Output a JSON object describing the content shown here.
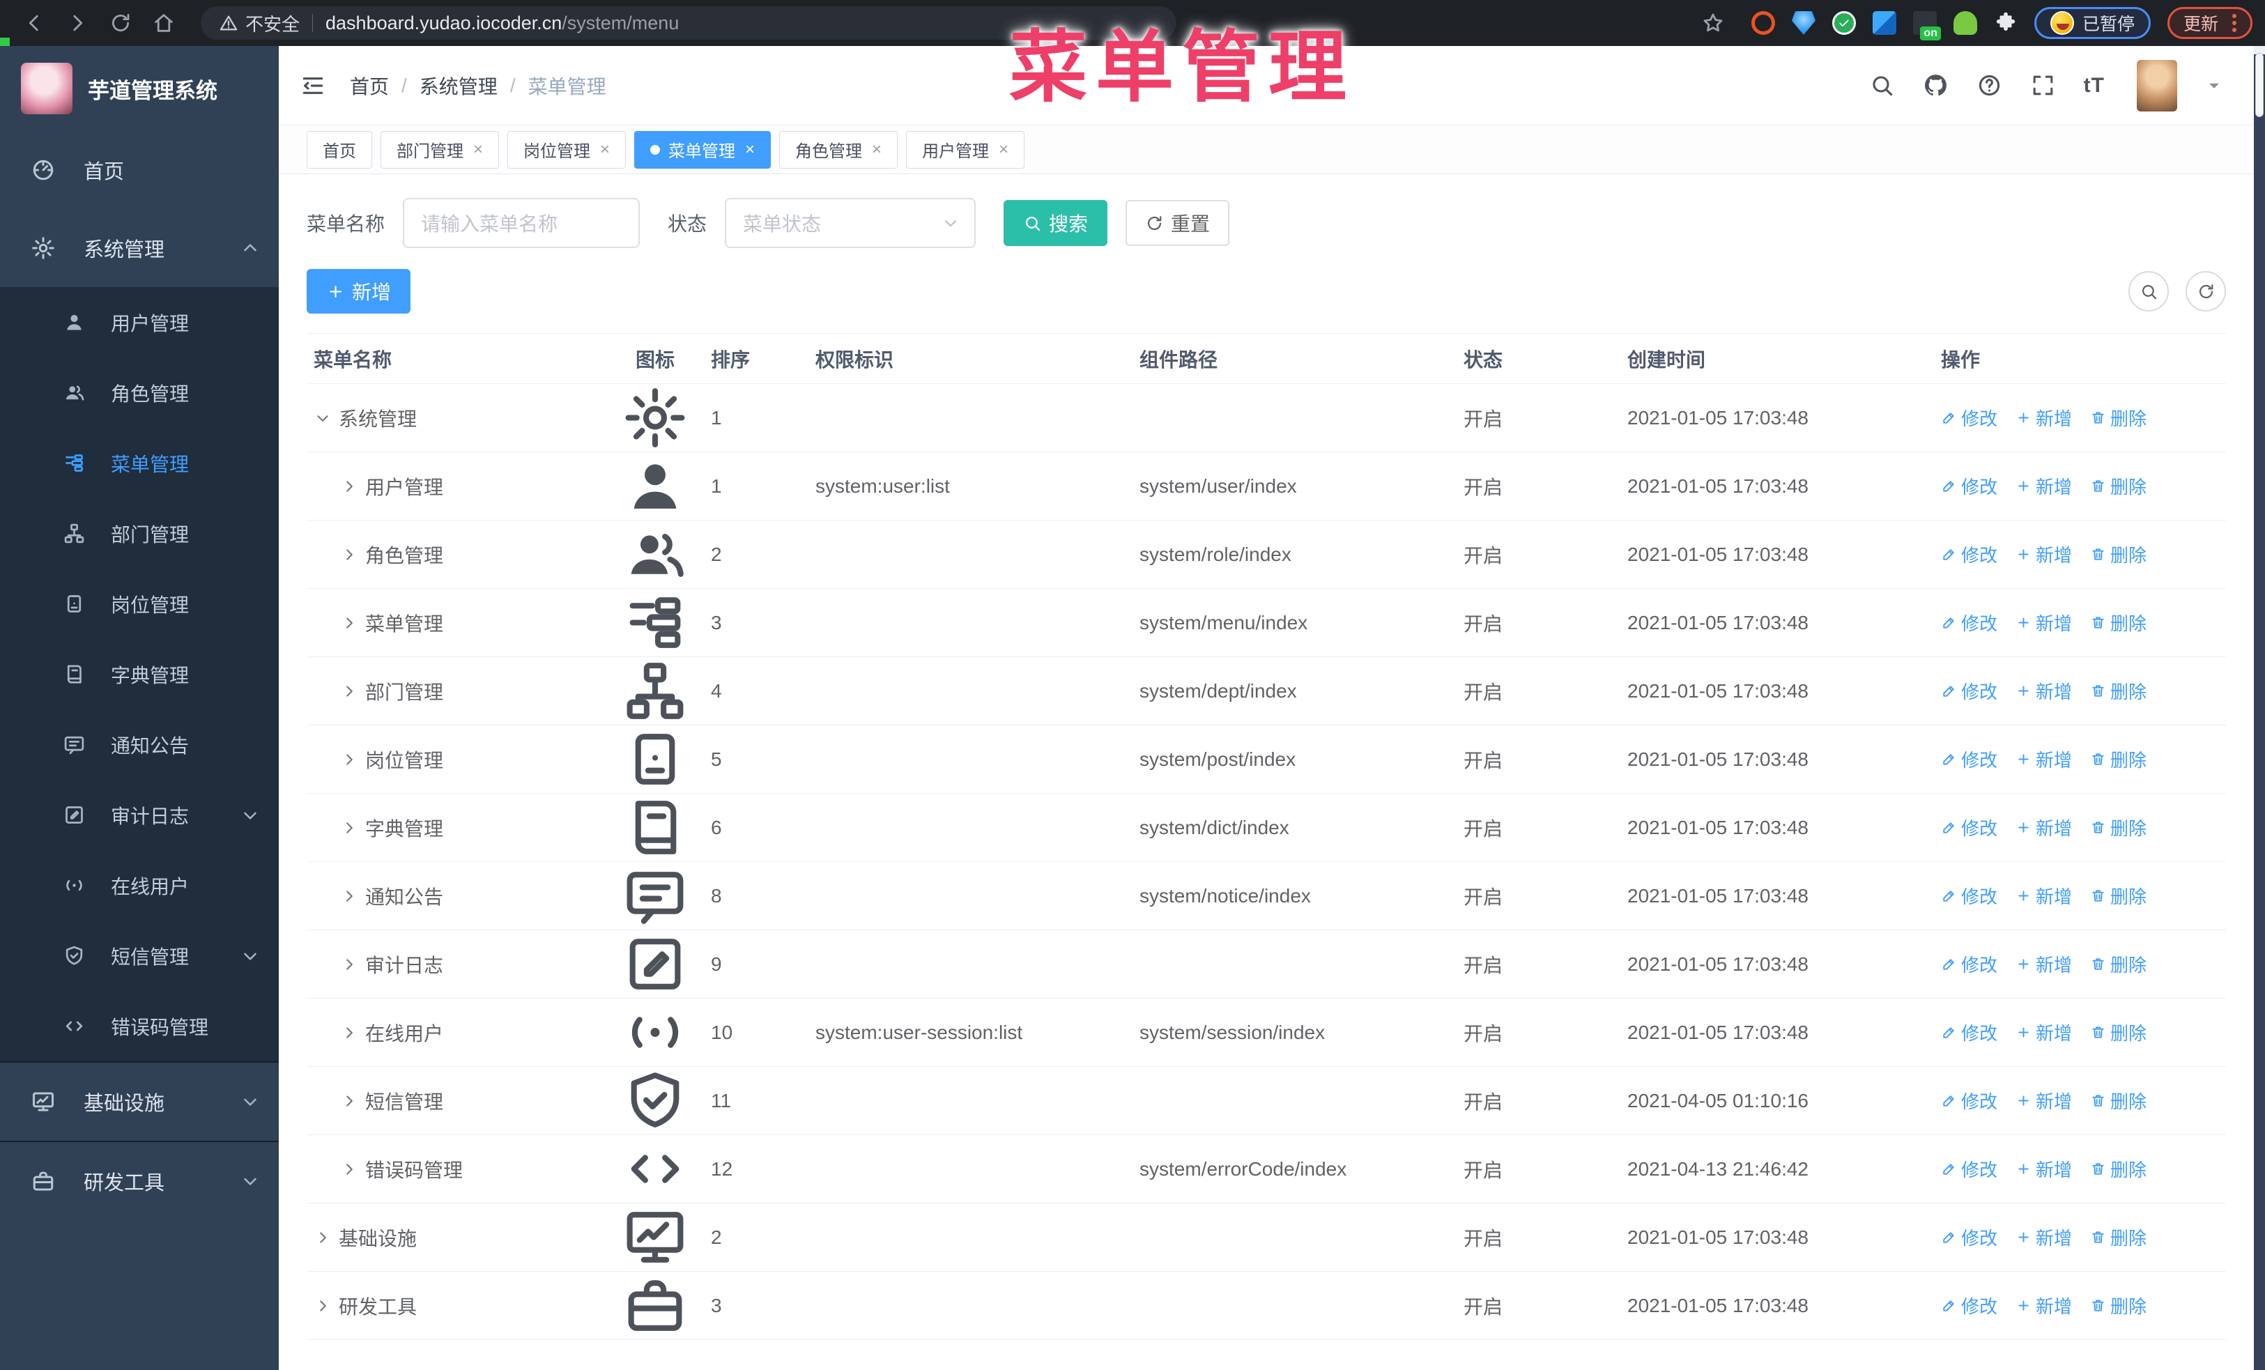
{
  "browser": {
    "security_label": "不安全",
    "url_host": "dashboard.yudao.iocoder.cn",
    "url_path": "/system/menu",
    "nav_icons": [
      "back-icon",
      "forward-icon",
      "reload-icon",
      "home-icon"
    ],
    "extension_icons": [
      "bookmark-star-icon",
      "orange-ring-icon",
      "blue-gem-icon",
      "green-check-icon",
      "blue-tiles-icon",
      "on-badge-icon",
      "green-bot-icon",
      "puzzle-icon"
    ],
    "on_badge": "on",
    "paused_chip": "已暂停",
    "update_button": "更新"
  },
  "overlay_title": "菜单管理",
  "sidebar": {
    "app_title": "芋道管理系统",
    "items": [
      {
        "label": "首页",
        "icon": "dashboard",
        "level": 0
      },
      {
        "label": "系统管理",
        "icon": "gear",
        "level": 0,
        "chevron": "chevron-up"
      },
      {
        "label": "用户管理",
        "icon": "user",
        "level": 1
      },
      {
        "label": "角色管理",
        "icon": "users",
        "level": 1
      },
      {
        "label": "菜单管理",
        "icon": "tree-table",
        "level": 1,
        "active": true
      },
      {
        "label": "部门管理",
        "icon": "org-tree",
        "level": 1
      },
      {
        "label": "岗位管理",
        "icon": "badge",
        "level": 1
      },
      {
        "label": "字典管理",
        "icon": "book",
        "level": 1
      },
      {
        "label": "通知公告",
        "icon": "message",
        "level": 1
      },
      {
        "label": "审计日志",
        "icon": "log",
        "level": 1,
        "chevron": "chevron-down"
      },
      {
        "label": "在线用户",
        "icon": "online",
        "level": 1
      },
      {
        "label": "短信管理",
        "icon": "shield",
        "level": 1,
        "chevron": "chevron-down"
      },
      {
        "label": "错误码管理",
        "icon": "code",
        "level": 1
      },
      {
        "label": "基础设施",
        "icon": "monitor",
        "level": 0,
        "chevron": "chevron-down"
      },
      {
        "label": "研发工具",
        "icon": "toolbox",
        "level": 0,
        "chevron": "chevron-down"
      }
    ]
  },
  "header": {
    "breadcrumb": [
      "首页",
      "系统管理",
      "菜单管理"
    ],
    "right_icons": [
      "search-icon",
      "github-icon",
      "question-icon",
      "fullscreen-icon",
      "font-size-icon",
      "avatar",
      "caret-down-icon"
    ],
    "font_size_glyph": "tT"
  },
  "tabs": [
    {
      "label": "首页",
      "closable": false,
      "active": false
    },
    {
      "label": "部门管理",
      "closable": true,
      "active": false
    },
    {
      "label": "岗位管理",
      "closable": true,
      "active": false
    },
    {
      "label": "菜单管理",
      "closable": true,
      "active": true
    },
    {
      "label": "角色管理",
      "closable": true,
      "active": false
    },
    {
      "label": "用户管理",
      "closable": true,
      "active": false
    }
  ],
  "filters": {
    "name_label": "菜单名称",
    "name_placeholder": "请输入菜单名称",
    "status_label": "状态",
    "status_placeholder": "菜单状态",
    "search_button": "搜索",
    "reset_button": "重置"
  },
  "toolbar": {
    "add_button": "新增"
  },
  "table": {
    "columns": [
      "菜单名称",
      "图标",
      "排序",
      "权限标识",
      "组件路径",
      "状态",
      "创建时间",
      "操作"
    ],
    "row_actions": [
      "修改",
      "新增",
      "删除"
    ],
    "rows": [
      {
        "level": 0,
        "expanded": true,
        "name": "系统管理",
        "icon": "gear",
        "sort": "1",
        "perm": "",
        "path": "",
        "status": "开启",
        "time": "2021-01-05 17:03:48"
      },
      {
        "level": 1,
        "name": "用户管理",
        "icon": "user",
        "sort": "1",
        "perm": "system:user:list",
        "path": "system/user/index",
        "status": "开启",
        "time": "2021-01-05 17:03:48"
      },
      {
        "level": 1,
        "name": "角色管理",
        "icon": "users",
        "sort": "2",
        "perm": "",
        "path": "system/role/index",
        "status": "开启",
        "time": "2021-01-05 17:03:48"
      },
      {
        "level": 1,
        "name": "菜单管理",
        "icon": "tree-table",
        "sort": "3",
        "perm": "",
        "path": "system/menu/index",
        "status": "开启",
        "time": "2021-01-05 17:03:48"
      },
      {
        "level": 1,
        "name": "部门管理",
        "icon": "org-tree",
        "sort": "4",
        "perm": "",
        "path": "system/dept/index",
        "status": "开启",
        "time": "2021-01-05 17:03:48"
      },
      {
        "level": 1,
        "name": "岗位管理",
        "icon": "badge",
        "sort": "5",
        "perm": "",
        "path": "system/post/index",
        "status": "开启",
        "time": "2021-01-05 17:03:48"
      },
      {
        "level": 1,
        "name": "字典管理",
        "icon": "book",
        "sort": "6",
        "perm": "",
        "path": "system/dict/index",
        "status": "开启",
        "time": "2021-01-05 17:03:48"
      },
      {
        "level": 1,
        "name": "通知公告",
        "icon": "message",
        "sort": "8",
        "perm": "",
        "path": "system/notice/index",
        "status": "开启",
        "time": "2021-01-05 17:03:48"
      },
      {
        "level": 1,
        "name": "审计日志",
        "icon": "log",
        "sort": "9",
        "perm": "",
        "path": "",
        "status": "开启",
        "time": "2021-01-05 17:03:48"
      },
      {
        "level": 1,
        "name": "在线用户",
        "icon": "online",
        "sort": "10",
        "perm": "system:user-session:list",
        "path": "system/session/index",
        "status": "开启",
        "time": "2021-01-05 17:03:48"
      },
      {
        "level": 1,
        "name": "短信管理",
        "icon": "shield",
        "sort": "11",
        "perm": "",
        "path": "",
        "status": "开启",
        "time": "2021-04-05 01:10:16"
      },
      {
        "level": 1,
        "name": "错误码管理",
        "icon": "code",
        "sort": "12",
        "perm": "",
        "path": "system/errorCode/index",
        "status": "开启",
        "time": "2021-04-13 21:46:42"
      },
      {
        "level": 0,
        "name": "基础设施",
        "icon": "monitor",
        "sort": "2",
        "perm": "",
        "path": "",
        "status": "开启",
        "time": "2021-01-05 17:03:48"
      },
      {
        "level": 0,
        "name": "研发工具",
        "icon": "toolbox",
        "sort": "3",
        "perm": "",
        "path": "",
        "status": "开启",
        "time": "2021-01-05 17:03:48"
      }
    ]
  }
}
